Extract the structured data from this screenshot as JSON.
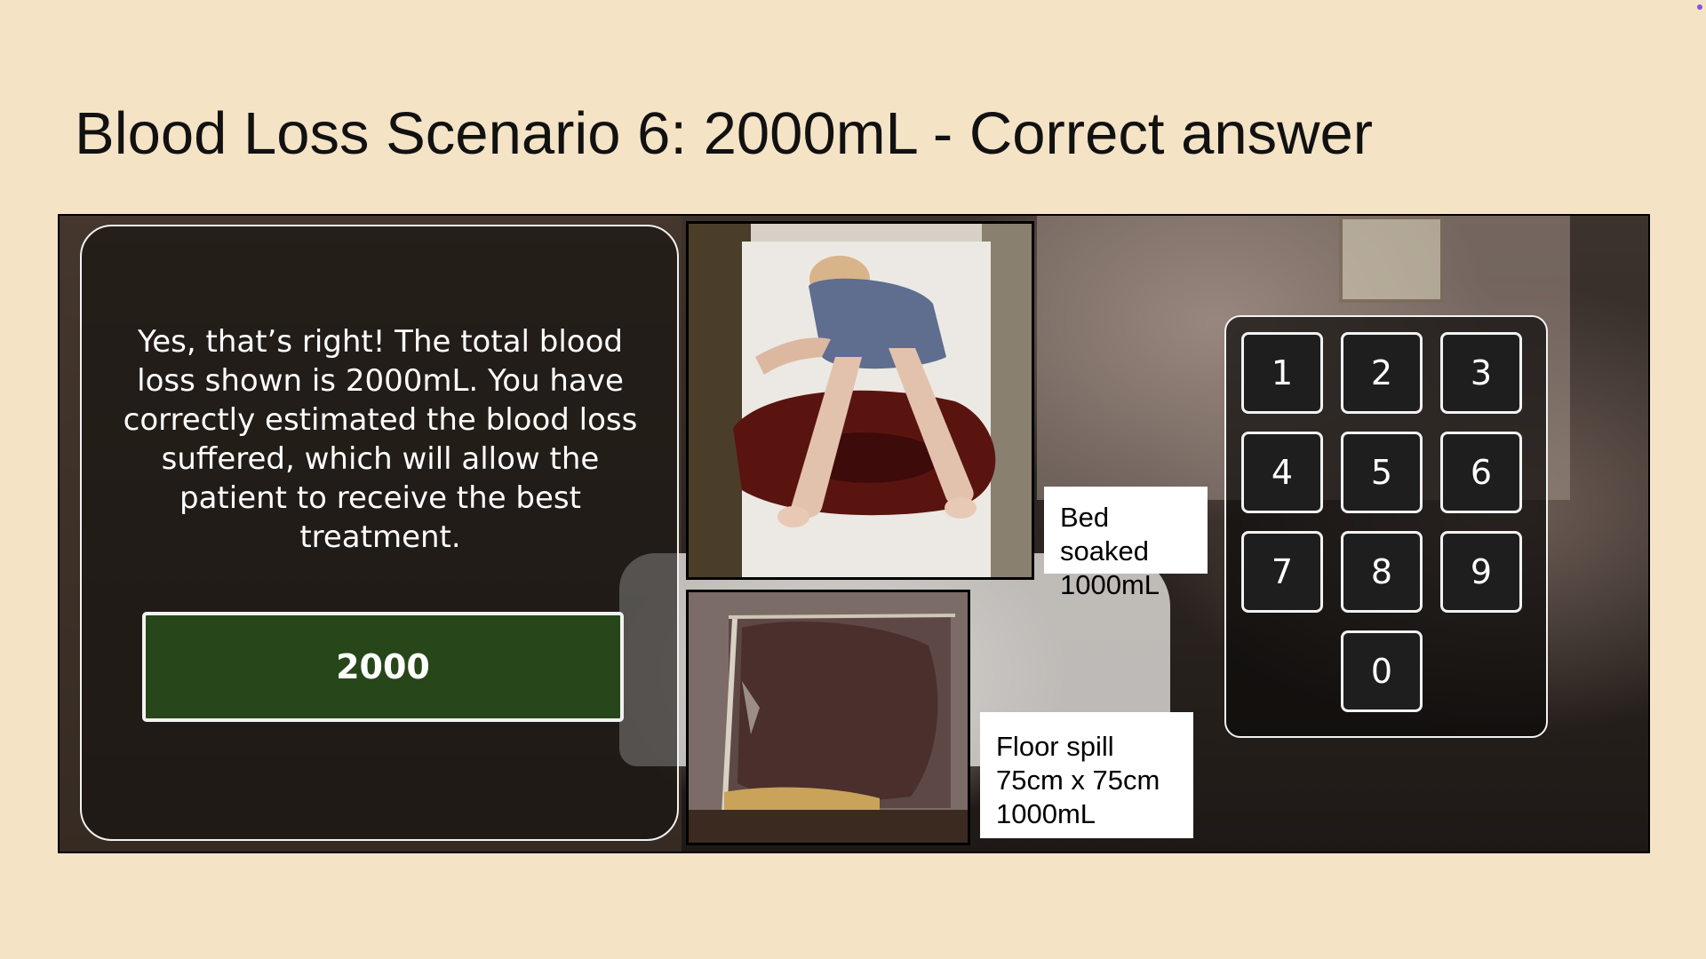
{
  "slide": {
    "title": "Blood Loss Scenario 6: 2000mL - Correct answer"
  },
  "feedback": {
    "message": "Yes, that’s right! The total blood loss shown is 2000mL. You have correctly estimated the blood loss suffered, which will allow the patient to receive the best treatment.",
    "answer": "2000"
  },
  "captions": {
    "bed": [
      "Bed soaked",
      "1000mL"
    ],
    "floor": [
      "Floor spill",
      "75cm x 75cm",
      "1000mL"
    ]
  },
  "keypad": {
    "keys": [
      "1",
      "2",
      "3",
      "4",
      "5",
      "6",
      "7",
      "8",
      "9",
      "0"
    ]
  },
  "colors": {
    "background": "#f5e3c6",
    "answer_fill": "#27461a",
    "panel_border": "#f2f2f2"
  }
}
